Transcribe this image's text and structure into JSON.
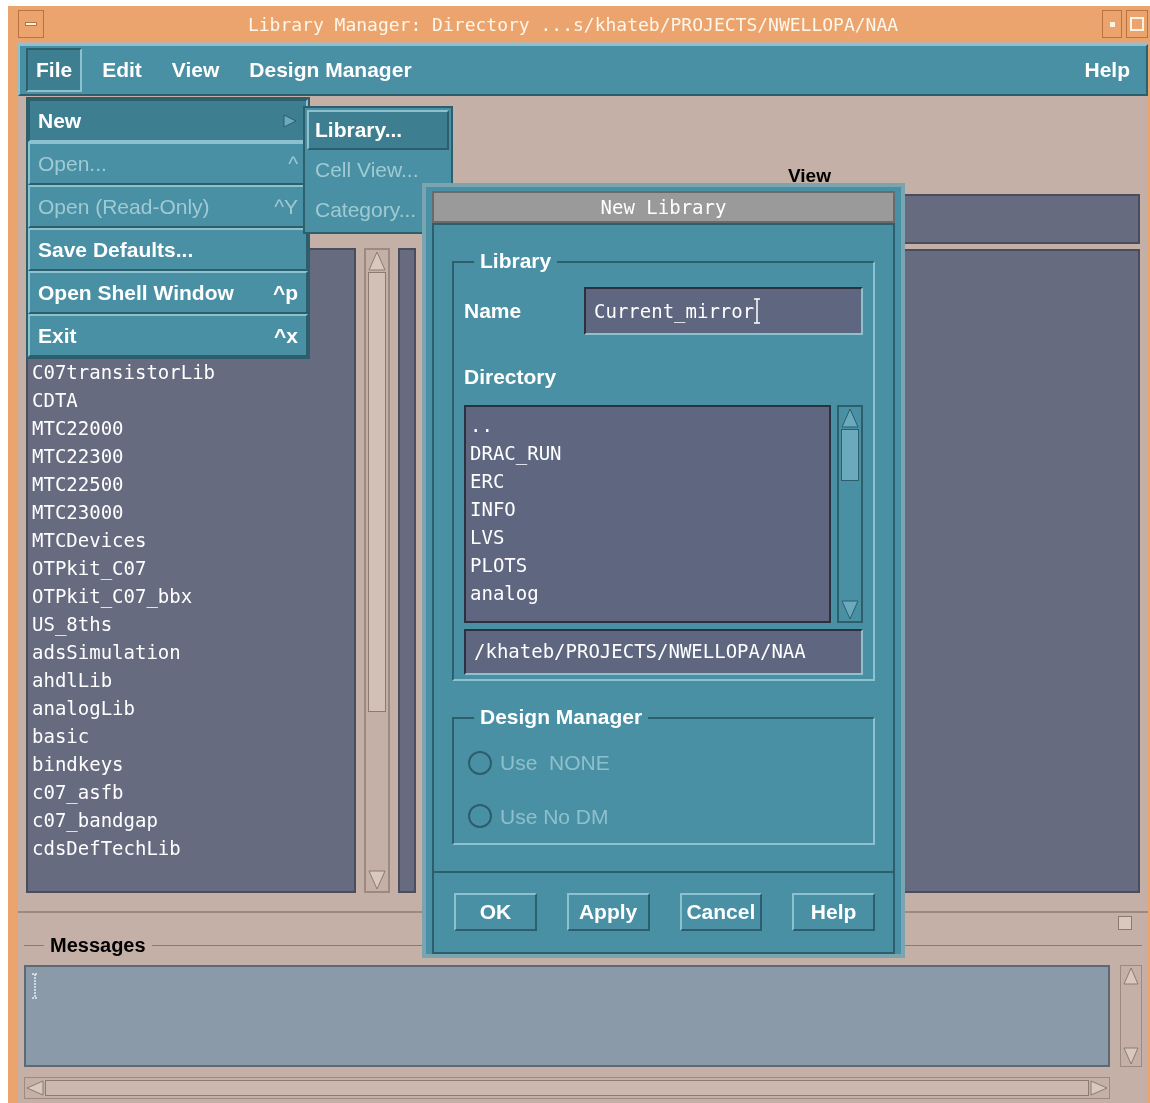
{
  "window": {
    "title": "Library Manager: Directory ...s/khateb/PROJECTS/NWELLOPA/NAA"
  },
  "menu_bar": [
    {
      "label": "File",
      "selected": true
    },
    {
      "label": "Edit",
      "selected": false
    },
    {
      "label": "View",
      "selected": false
    },
    {
      "label": "Design Manager",
      "selected": false
    },
    {
      "label": "Help",
      "selected": false
    }
  ],
  "file_menu": [
    {
      "label": "New",
      "kind": "submenu",
      "selected": true,
      "disabled": false
    },
    {
      "label": "Open...",
      "kind": "item",
      "shortcut": "^",
      "selected": false,
      "disabled": true
    },
    {
      "label": "Open (Read-Only)",
      "kind": "item",
      "shortcut": "^Y",
      "selected": false,
      "disabled": true
    },
    {
      "label": "Save Defaults...",
      "kind": "item",
      "selected": false,
      "disabled": false
    },
    {
      "label": "Open Shell Window",
      "kind": "item",
      "shortcut": "^p",
      "selected": false,
      "disabled": false
    },
    {
      "label": "Exit",
      "kind": "item",
      "shortcut": "^x",
      "selected": false,
      "disabled": false
    }
  ],
  "new_submenu": [
    {
      "label": "Library...",
      "selected": true,
      "disabled": false
    },
    {
      "label": "Cell View...",
      "selected": false,
      "disabled": true
    },
    {
      "label": "Category...",
      "selected": false,
      "disabled": true
    }
  ],
  "libraries": [
    "C07transistorLib",
    "CDTA",
    "MTC22000",
    "MTC22300",
    "MTC22500",
    "MTC23000",
    "MTCDevices",
    "OTPkit_C07",
    "OTPkit_C07_bbx",
    "US_8ths",
    "adsSimulation",
    "ahdlLib",
    "analogLib",
    "basic",
    "bindkeys",
    "c07_asfb",
    "c07_bandgap",
    "cdsDefTechLib"
  ],
  "view_column": {
    "label": "View"
  },
  "dialog": {
    "title": "New Library",
    "library_group": {
      "label": "Library",
      "name_label": "Name",
      "name_value": "Current_mirror",
      "directory_label": "Directory",
      "directories": [
        "..",
        "DRAC_RUN",
        "ERC",
        "INFO",
        "LVS",
        "PLOTS",
        "analog"
      ],
      "path": "/khateb/PROJECTS/NWELLOPA/NAA"
    },
    "design_manager": {
      "label": "Design Manager",
      "options": [
        {
          "label": "Use  NONE",
          "selected": false,
          "disabled": true
        },
        {
          "label": "Use No DM",
          "selected": false,
          "disabled": true
        }
      ]
    },
    "buttons": [
      "OK",
      "Apply",
      "Cancel",
      "Help"
    ]
  },
  "messages": {
    "label": "Messages"
  }
}
